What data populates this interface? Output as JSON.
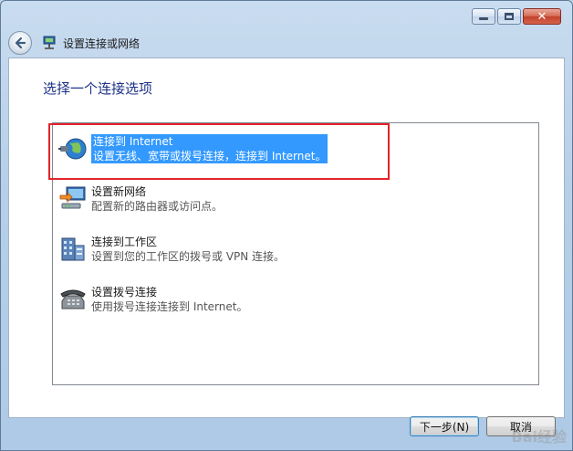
{
  "window": {
    "title": "设置连接或网络"
  },
  "main": {
    "heading": "选择一个连接选项",
    "options": [
      {
        "title": "连接到 Internet",
        "desc": "设置无线、宽带或拨号连接，连接到 Internet。",
        "icon": "globe-connect-icon",
        "selected": true
      },
      {
        "title": "设置新网络",
        "desc": "配置新的路由器或访问点。",
        "icon": "new-network-icon",
        "selected": false
      },
      {
        "title": "连接到工作区",
        "desc": "设置到您的工作区的拨号或 VPN 连接。",
        "icon": "workplace-icon",
        "selected": false
      },
      {
        "title": "设置拨号连接",
        "desc": "使用拨号连接连接到 Internet。",
        "icon": "dialup-phone-icon",
        "selected": false
      }
    ]
  },
  "footer": {
    "next_label": "下一步(N)",
    "cancel_label": "取消"
  },
  "watermark": "Bai经验",
  "colors": {
    "heading": "#1e3287",
    "selection": "#3399ff",
    "highlight_frame": "#e3232a"
  }
}
